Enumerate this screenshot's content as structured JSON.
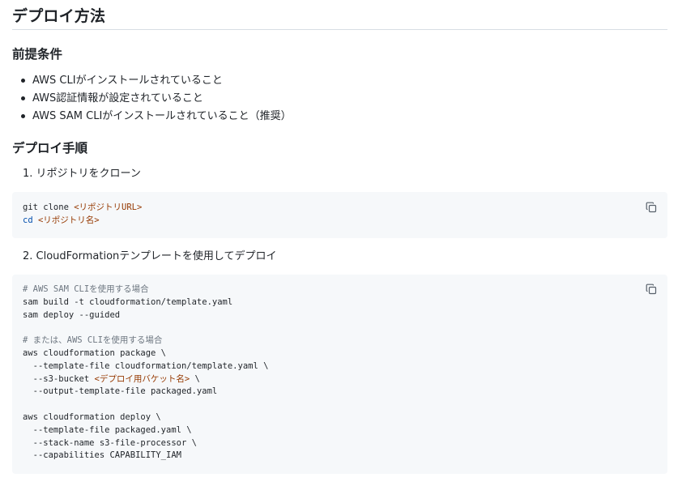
{
  "heading": "デプロイ方法",
  "prerequisites": {
    "heading": "前提条件",
    "items": [
      "AWS CLIがインストールされていること",
      "AWS認証情報が設定されていること",
      "AWS SAM CLIがインストールされていること（推奨）"
    ]
  },
  "deploy_steps": {
    "heading": "デプロイ手順",
    "step1": {
      "label": "1. リポジトリをクローン",
      "code": {
        "line1_cmd": "git clone ",
        "line1_ph": "<リポジトリURL>",
        "line2_kw": "cd",
        "line2_sp": " ",
        "line2_ph": "<リポジトリ名>"
      }
    },
    "step2": {
      "label": "2. CloudFormationテンプレートを使用してデプロイ",
      "code": {
        "comment1": "# AWS SAM CLIを使用する場合",
        "l2": "sam build -t cloudformation/template.yaml",
        "l3": "sam deploy --guided",
        "comment2": "# または、AWS CLIを使用する場合",
        "l6": "aws cloudformation package \\",
        "l7": "  --template-file cloudformation/template.yaml \\",
        "l8_pre": "  --s3-bucket ",
        "l8_ph": "<デプロイ用バケット名>",
        "l8_post": " \\",
        "l9": "  --output-template-file packaged.yaml",
        "l11": "aws cloudformation deploy \\",
        "l12": "  --template-file packaged.yaml \\",
        "l13": "  --stack-name s3-file-processor \\",
        "l14": "  --capabilities CAPABILITY_IAM"
      }
    }
  },
  "icons": {
    "copy": "copy-icon"
  }
}
